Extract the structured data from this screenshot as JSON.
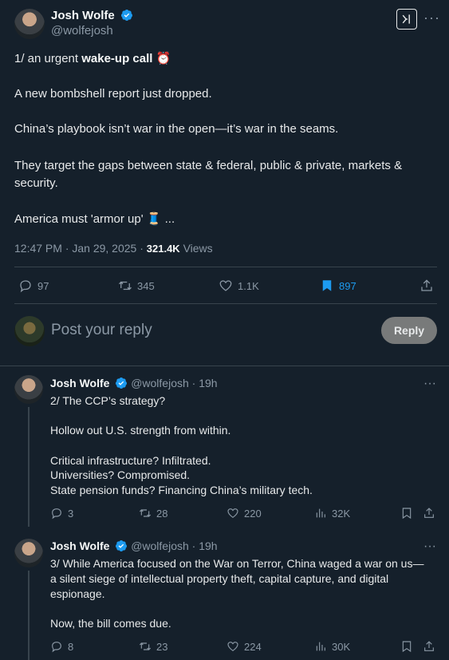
{
  "main_post": {
    "author_name": "Josh Wolfe",
    "author_handle": "@wolfejosh",
    "line1_prefix": "1/ an urgent ",
    "line1_bold": "wake-up call",
    "line1_emoji": "⏰",
    "para2": "A new bombshell report just dropped.",
    "para3": "China’s playbook isn’t war in the open—it’s war in the seams.",
    "para4": "They target the gaps between state & federal, public & private, markets & security.",
    "para5_text": "America must 'armor up'",
    "para5_emoji": "🧵",
    "para5_tail": "...",
    "timestamp": "12:47 PM · Jan 29, 2025 · ",
    "views_count": "321.4K",
    "views_label": " Views",
    "stats": {
      "replies": "97",
      "reposts": "345",
      "likes": "1.1K",
      "bookmarks": "897"
    }
  },
  "reply_box": {
    "placeholder": "Post your reply",
    "button": "Reply"
  },
  "replies": [
    {
      "author_name": "Josh Wolfe",
      "author_handle": "@wolfejosh",
      "time": "· 19h",
      "lines": [
        "2/ The CCP’s strategy?",
        "Hollow out U.S. strength from within.",
        "Critical infrastructure? Infiltrated.",
        "Universities? Compromised.",
        "State pension funds? Financing China’s military tech."
      ],
      "stats": {
        "replies": "3",
        "reposts": "28",
        "likes": "220",
        "views": "32K"
      }
    },
    {
      "author_name": "Josh Wolfe",
      "author_handle": "@wolfejosh",
      "time": "· 19h",
      "lines": [
        "3/ While America focused on the War on Terror, China waged a war on us—",
        "a silent siege of intellectual property theft, capital capture, and digital",
        "espionage.",
        "Now, the bill comes due."
      ],
      "stats": {
        "replies": "8",
        "reposts": "23",
        "likes": "224",
        "views": "30K"
      }
    }
  ],
  "colors": {
    "background": "#15202b",
    "accent": "#1d9bf0",
    "muted": "#8b98a5"
  },
  "icons": [
    "verified-badge-icon",
    "grok-icon",
    "more-icon",
    "reply-icon",
    "repost-icon",
    "like-icon",
    "bookmark-icon",
    "share-icon",
    "views-icon"
  ]
}
